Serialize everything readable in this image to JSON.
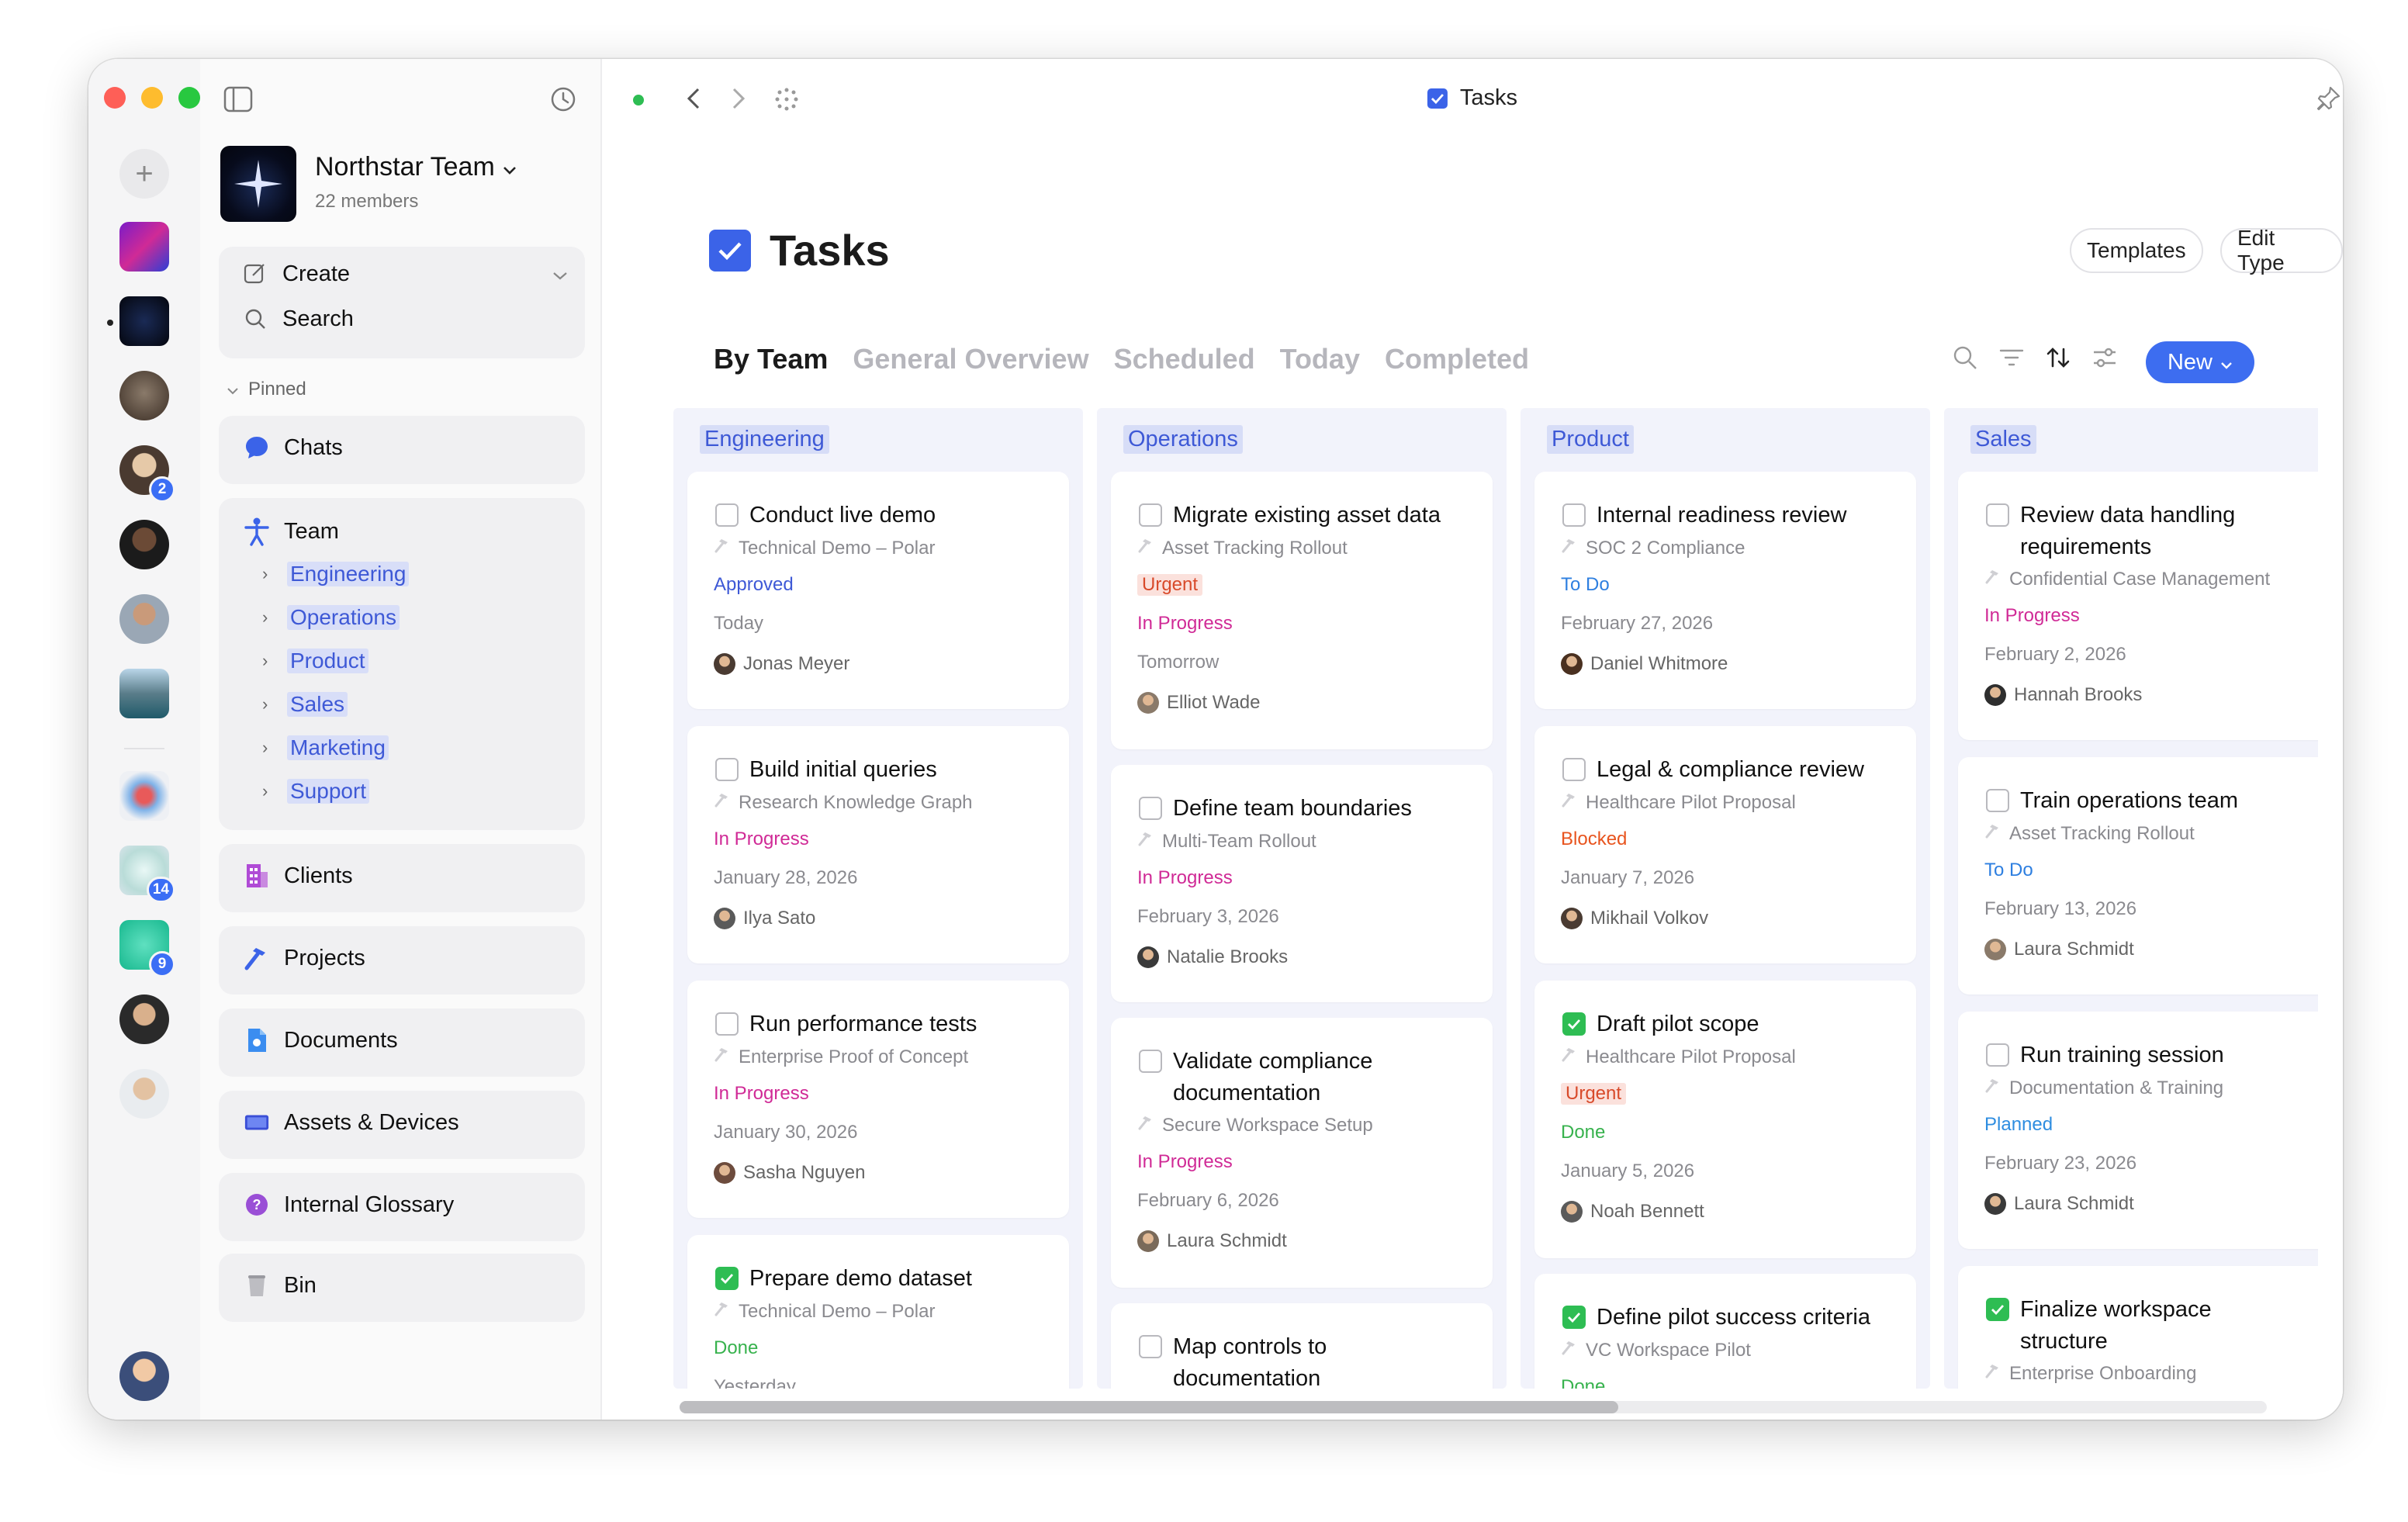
{
  "window": {
    "title": "Tasks"
  },
  "sidebar": {
    "team_name": "Northstar Team",
    "team_members": "22 members",
    "create_label": "Create",
    "search_label": "Search",
    "pinned_label": "Pinned",
    "chats_label": "Chats",
    "team_label": "Team",
    "team_items": [
      "Engineering",
      "Operations",
      "Product",
      "Sales",
      "Marketing",
      "Support"
    ],
    "clients_label": "Clients",
    "projects_label": "Projects",
    "documents_label": "Documents",
    "assets_label": "Assets & Devices",
    "glossary_label": "Internal Glossary",
    "bin_label": "Bin"
  },
  "rail": {
    "badges": [
      "2",
      "14",
      "9"
    ]
  },
  "page": {
    "title": "Tasks",
    "templates_label": "Templates",
    "edit_type_label": "Edit Type",
    "new_label": "New",
    "tabs": [
      "By Team",
      "General Overview",
      "Scheduled",
      "Today",
      "Completed"
    ]
  },
  "columns": [
    {
      "name": "Engineering",
      "tasks": [
        {
          "title": "Conduct live demo",
          "project": "Technical Demo – Polar",
          "status": "Approved",
          "date": "Today",
          "assignee": "Jonas Meyer",
          "done": false
        },
        {
          "title": "Build initial queries",
          "project": "Research Knowledge Graph",
          "status": "In Progress",
          "date": "January 28, 2026",
          "assignee": "Ilya Sato",
          "done": false
        },
        {
          "title": "Run performance tests",
          "project": "Enterprise Proof of Concept",
          "status": "In Progress",
          "date": "January 30, 2026",
          "assignee": "Sasha Nguyen",
          "done": false
        },
        {
          "title": "Prepare demo dataset",
          "project": "Technical Demo – Polar",
          "status": "Done",
          "date": "Yesterday",
          "done": true
        }
      ]
    },
    {
      "name": "Operations",
      "tasks": [
        {
          "title": "Migrate existing asset data",
          "project": "Asset Tracking Rollout",
          "tag": "Urgent",
          "status": "In Progress",
          "date": "Tomorrow",
          "assignee": "Elliot Wade",
          "done": false
        },
        {
          "title": "Define team boundaries",
          "project": "Multi-Team Rollout",
          "status": "In Progress",
          "date": "February 3, 2026",
          "assignee": "Natalie Brooks",
          "done": false
        },
        {
          "title": "Validate compliance",
          "title2": "documentation",
          "project": "Secure Workspace Setup",
          "status": "In Progress",
          "date": "February 6, 2026",
          "assignee": "Laura Schmidt",
          "done": false
        },
        {
          "title": "Map controls to",
          "title2": "documentation",
          "done": false
        }
      ]
    },
    {
      "name": "Product",
      "tasks": [
        {
          "title": "Internal readiness review",
          "project": "SOC 2 Compliance",
          "status": "To Do",
          "date": "February 27, 2026",
          "assignee": "Daniel Whitmore",
          "done": false
        },
        {
          "title": "Legal & compliance review",
          "project": "Healthcare Pilot Proposal",
          "status": "Blocked",
          "date": "January 7, 2026",
          "assignee": "Mikhail Volkov",
          "done": false
        },
        {
          "title": "Draft pilot scope",
          "project": "Healthcare Pilot Proposal",
          "tag": "Urgent",
          "status": "Done",
          "date": "January 5, 2026",
          "assignee": "Noah Bennett",
          "done": true
        },
        {
          "title": "Define pilot success criteria",
          "project": "VC Workspace Pilot",
          "status": "Done",
          "done": true
        }
      ]
    },
    {
      "name": "Sales",
      "tasks": [
        {
          "title": "Review data handling",
          "title2": "requirements",
          "project": "Confidential Case Management",
          "status": "In Progress",
          "date": "February 2, 2026",
          "assignee": "Hannah Brooks",
          "done": false
        },
        {
          "title": "Train operations team",
          "project": "Asset Tracking Rollout",
          "status": "To Do",
          "date": "February 13, 2026",
          "assignee": "Laura Schmidt",
          "done": false
        },
        {
          "title": "Run training session",
          "project": "Documentation & Training",
          "status": "Planned",
          "date": "February 23, 2026",
          "assignee": "Laura Schmidt",
          "done": false
        },
        {
          "title": "Finalize workspace",
          "title2": "structure",
          "project": "Enterprise Onboarding",
          "done": true
        }
      ]
    }
  ],
  "colors": {
    "accent": "#3d6df0",
    "in_progress": "#d02a96",
    "done": "#37b24d",
    "urgent": "#d84a2a",
    "column_bg": "#f2f3fb"
  }
}
